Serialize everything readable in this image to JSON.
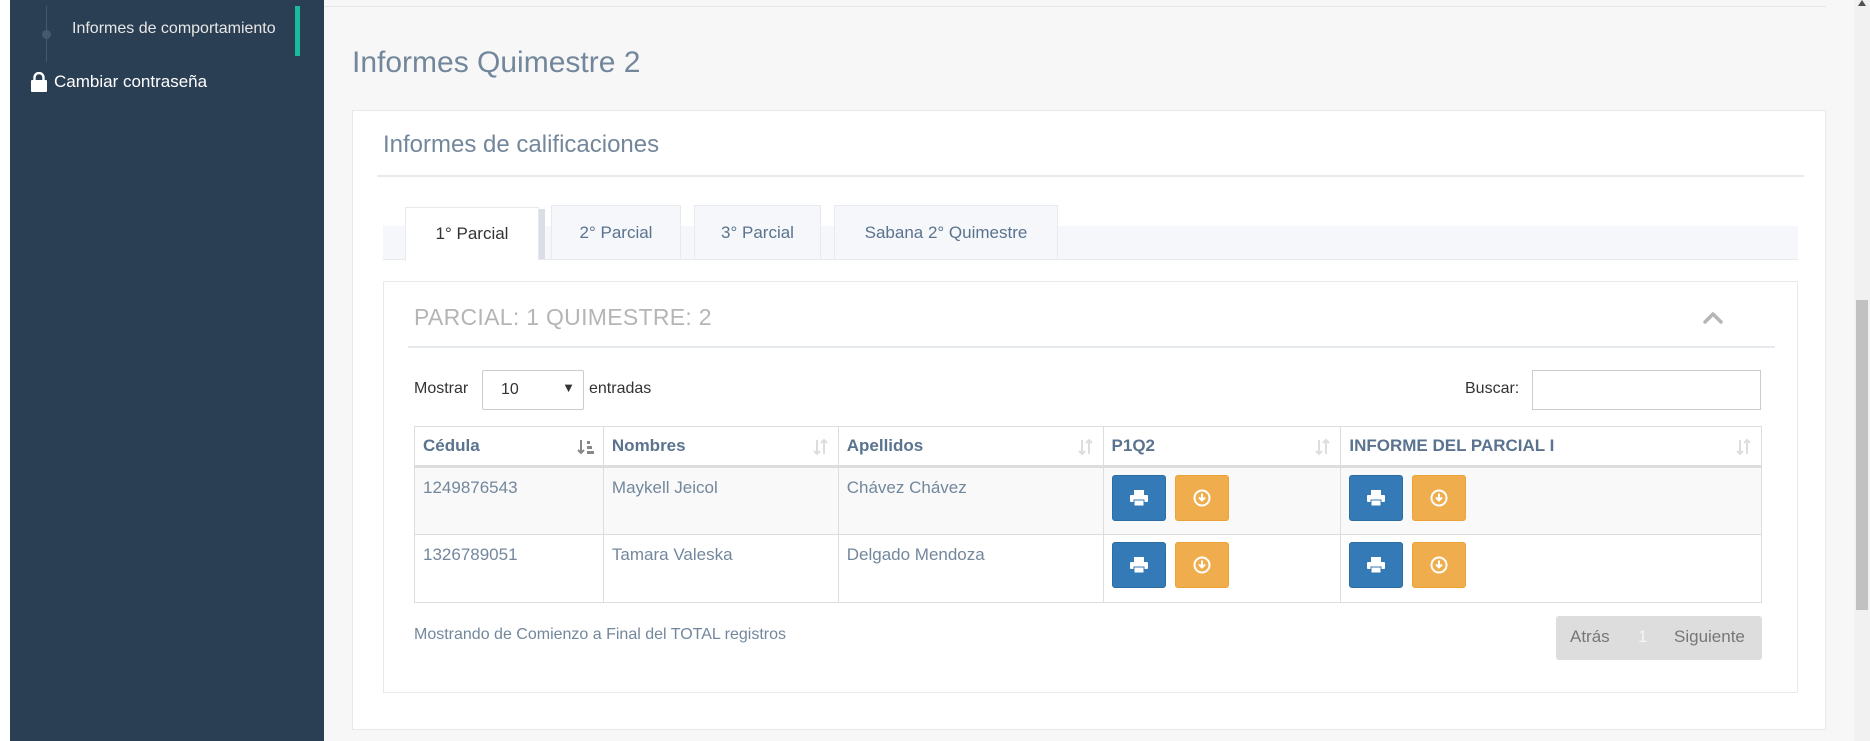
{
  "sidebar": {
    "sub_item_label": "Informes de comportamiento",
    "nav_item_label": "Cambiar contraseña"
  },
  "page": {
    "title": "Informes Quimestre 2"
  },
  "panel": {
    "title": "Informes de calificaciones",
    "tabs": [
      "1° Parcial",
      "2° Parcial",
      "3° Parcial",
      "Sabana 2° Quimestre"
    ],
    "active_tab": "1° Parcial"
  },
  "section": {
    "title": "PARCIAL: 1 QUIMESTRE: 2",
    "show_label": "Mostrar",
    "page_size": "10",
    "entries_label": "entradas",
    "search_label": "Buscar:",
    "search_value": ""
  },
  "table": {
    "headers": [
      "Cédula",
      "Nombres",
      "Apellidos",
      "P1Q2",
      "INFORME DEL PARCIAL I"
    ],
    "rows": [
      {
        "cedula": "1249876543",
        "nombres": "Maykell Jeicol",
        "apellidos": "Chávez Chávez"
      },
      {
        "cedula": "1326789051",
        "nombres": "Tamara Valeska",
        "apellidos": "Delgado Mendoza"
      }
    ]
  },
  "footer": {
    "info": "Mostrando de Comienzo a Final del TOTAL registros",
    "prev_label": "Atrás",
    "current_page": "1",
    "next_label": "Siguiente"
  },
  "colors": {
    "sidebar_bg": "#2a3f54",
    "accent": "#1abb9c",
    "primary_button": "#337ab7",
    "warning_button": "#f0ad4e"
  },
  "icons": [
    "lock-icon",
    "chevron-up-icon",
    "sort-icon",
    "print-icon",
    "download-icon"
  ]
}
